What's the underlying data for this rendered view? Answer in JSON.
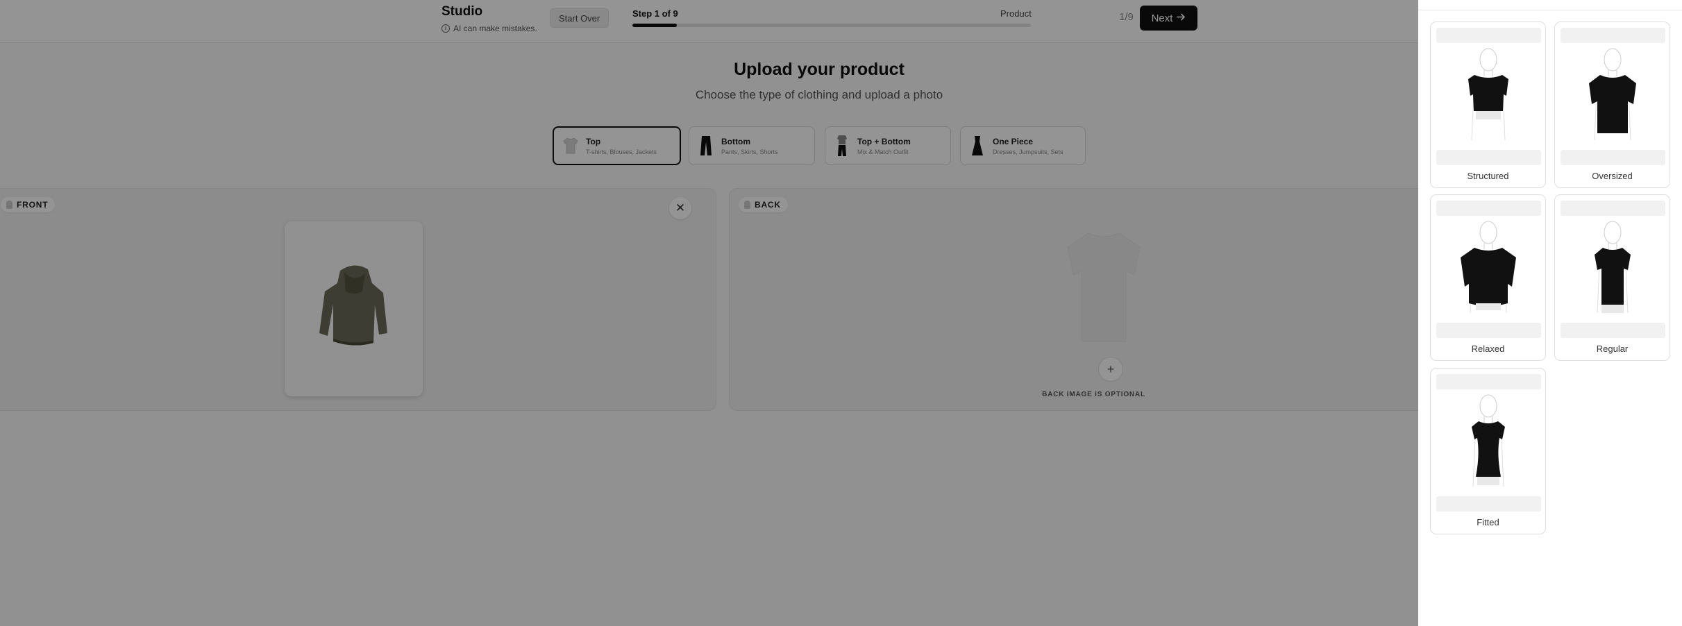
{
  "header": {
    "title": "Studio",
    "warning": "AI can make mistakes.",
    "start_over_label": "Start Over",
    "step_label": "Step 1 of 9",
    "step_name": "Product",
    "progress": 0.111,
    "counter": "1/9",
    "next_label": "Next"
  },
  "main": {
    "title": "Upload your product",
    "subtitle": "Choose the type of clothing and upload a photo",
    "types": [
      {
        "name": "Top",
        "desc": "T-shirts, Blouses, Jackets",
        "icon": "tshirt-icon",
        "selected": true
      },
      {
        "name": "Bottom",
        "desc": "Pants, Skirts, Shorts",
        "icon": "pants-icon",
        "selected": false
      },
      {
        "name": "Top + Bottom",
        "desc": "Mix & Match Outfit",
        "icon": "outfit-icon",
        "selected": false
      },
      {
        "name": "One Piece",
        "desc": "Dresses, Jumpsuits, Sets",
        "icon": "dress-icon",
        "selected": false
      }
    ],
    "front": {
      "label": "FRONT"
    },
    "back": {
      "label": "BACK",
      "optional_text": "BACK IMAGE IS OPTIONAL"
    }
  },
  "drawer": {
    "fits": [
      {
        "label": "Structured"
      },
      {
        "label": "Oversized"
      },
      {
        "label": "Relaxed"
      },
      {
        "label": "Regular"
      },
      {
        "label": "Fitted"
      }
    ]
  },
  "colors": {
    "accent": "#111111",
    "overlay": "#000000"
  }
}
